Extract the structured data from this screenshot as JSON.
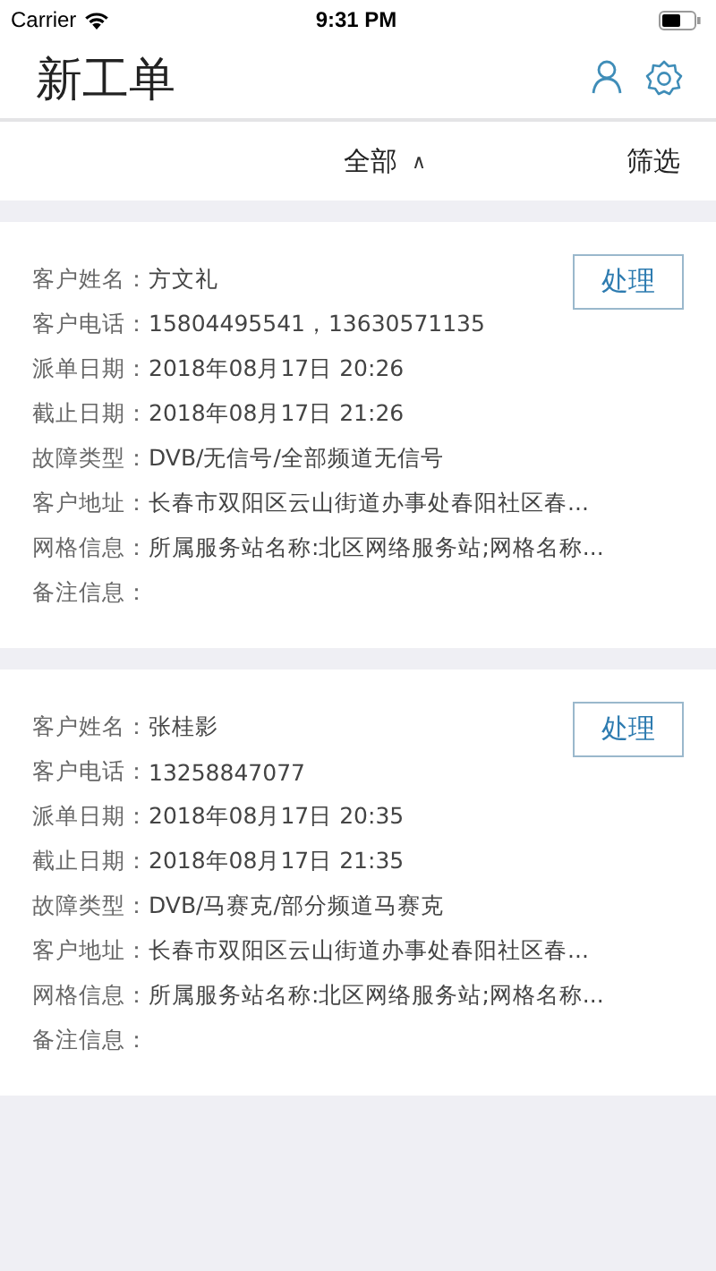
{
  "status_bar": {
    "carrier": "Carrier",
    "time": "9:31 PM"
  },
  "header": {
    "title": "新工单"
  },
  "filter_bar": {
    "dropdown": "全部",
    "dropdown_caret": "∧",
    "filter": "筛选"
  },
  "orders": [
    {
      "button": "处理",
      "fields": [
        {
          "label": "客户姓名：",
          "value": "方文礼"
        },
        {
          "label": "客户电话：",
          "value": "15804495541，13630571135"
        },
        {
          "label": "派单日期：",
          "value": "2018年08月17日 20:26"
        },
        {
          "label": "截止日期：",
          "value": "2018年08月17日 21:26"
        },
        {
          "label": "故障类型：",
          "value": "DVB/无信号/全部频道无信号"
        },
        {
          "label": "客户地址：",
          "value": "长春市双阳区云山街道办事处春阳社区春..."
        },
        {
          "label": "网格信息：",
          "value": "所属服务站名称:北区网络服务站;网格名称..."
        },
        {
          "label": "备注信息："
        }
      ]
    },
    {
      "button": "处理",
      "fields": [
        {
          "label": "客户姓名：",
          "value": "张桂影"
        },
        {
          "label": "客户电话：",
          "value": "13258847077"
        },
        {
          "label": "派单日期：",
          "value": "2018年08月17日 20:35"
        },
        {
          "label": "截止日期：",
          "value": "2018年08月17日 21:35"
        },
        {
          "label": "故障类型：",
          "value": "DVB/马赛克/部分频道马赛克"
        },
        {
          "label": "客户地址：",
          "value": "长春市双阳区云山街道办事处春阳社区春..."
        },
        {
          "label": "网格信息：",
          "value": "所属服务站名称:北区网络服务站;网格名称..."
        },
        {
          "label": "备注信息："
        }
      ]
    }
  ]
}
